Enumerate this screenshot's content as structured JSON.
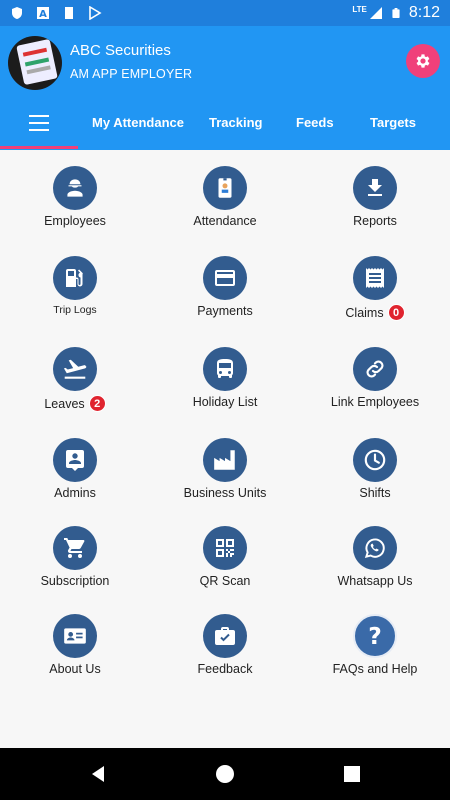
{
  "status_bar": {
    "time": "8:12",
    "network": "LTE",
    "icons": [
      "shield-icon",
      "a-icon",
      "sd-card-icon",
      "play-store-icon",
      "signal-icon",
      "battery-icon"
    ]
  },
  "header": {
    "company": "ABC Securities",
    "role": "AM APP EMPLOYER",
    "accent_color": "#2196f3",
    "settings_color": "#f0407a"
  },
  "tabs": [
    {
      "label": "My Attendance"
    },
    {
      "label": "Tracking"
    },
    {
      "label": "Feeds"
    },
    {
      "label": "Targets"
    }
  ],
  "tiles": [
    {
      "label": "Employees",
      "icon": "worker-icon"
    },
    {
      "label": "Attendance",
      "icon": "id-badge-icon"
    },
    {
      "label": "Reports",
      "icon": "download-icon"
    },
    {
      "label": "Trip Logs",
      "icon": "fuel-icon"
    },
    {
      "label": "Payments",
      "icon": "credit-card-icon"
    },
    {
      "label": "Claims",
      "icon": "receipt-icon",
      "badge": "0"
    },
    {
      "label": "Leaves",
      "icon": "flight-takeoff-icon",
      "badge": "2"
    },
    {
      "label": "Holiday List",
      "icon": "bus-icon"
    },
    {
      "label": "Link Employees",
      "icon": "link-icon"
    },
    {
      "label": "Admins",
      "icon": "admin-person-icon"
    },
    {
      "label": "Business Units",
      "icon": "factory-icon"
    },
    {
      "label": "Shifts",
      "icon": "clock-icon"
    },
    {
      "label": "Subscription",
      "icon": "cart-icon"
    },
    {
      "label": "QR Scan",
      "icon": "qr-code-icon"
    },
    {
      "label": "Whatsapp Us",
      "icon": "whatsapp-icon"
    },
    {
      "label": "About Us",
      "icon": "contact-card-icon"
    },
    {
      "label": "Feedback",
      "icon": "briefcase-check-icon"
    },
    {
      "label": "FAQs and Help",
      "icon": "question-icon"
    }
  ]
}
